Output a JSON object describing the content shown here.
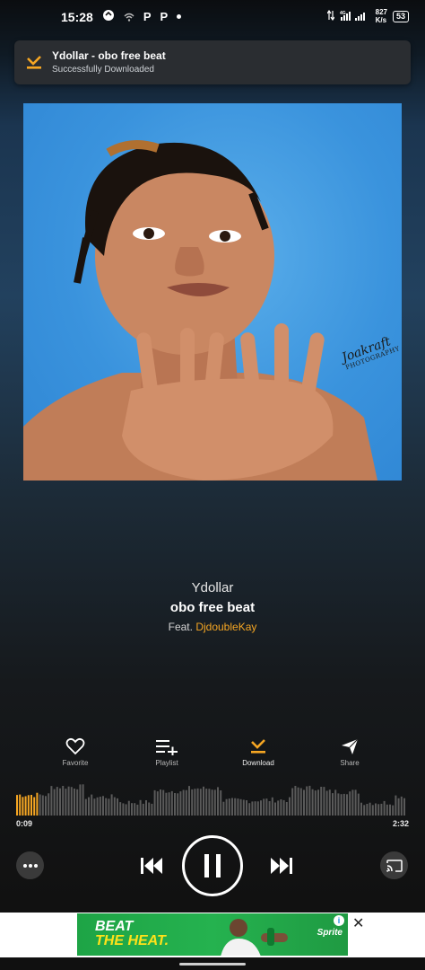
{
  "status_bar": {
    "time": "15:28",
    "icons": [
      "sync-icon",
      "wifi-icon",
      "p-app-icon",
      "p-app-icon",
      "dot"
    ],
    "p1": "P",
    "p2": "P",
    "net_type": "4G",
    "net_speed_value": "827",
    "net_speed_unit": "K/s",
    "battery": "53"
  },
  "notification": {
    "title": "Ydollar - obo free beat",
    "subtitle": "Successfully Downloaded",
    "icon": "download-done-icon",
    "accent": "#f5a623"
  },
  "cover": {
    "signature_line1": "Joakraft",
    "signature_line2": "PHOTOGRAPHY"
  },
  "track": {
    "artist": "Ydollar",
    "title": "obo free beat",
    "feat_prefix": "Feat.",
    "feat_artist": "DjdoubleKay"
  },
  "actions": [
    {
      "label": "Favorite",
      "icon": "heart-icon"
    },
    {
      "label": "Playlist",
      "icon": "playlist-add-icon"
    },
    {
      "label": "Download",
      "icon": "download-done-icon",
      "active": true
    },
    {
      "label": "Share",
      "icon": "share-icon"
    }
  ],
  "player": {
    "elapsed": "0:09",
    "duration": "2:32",
    "progress_fraction": 0.06,
    "state": "playing"
  },
  "ad": {
    "line1": "BEAT",
    "line2": "THE HEAT.",
    "brand": "Sprite",
    "info_glyph": "i",
    "close_glyph": "✕"
  },
  "colors": {
    "accent": "#f5a623",
    "ad_green": "#22a84a"
  }
}
